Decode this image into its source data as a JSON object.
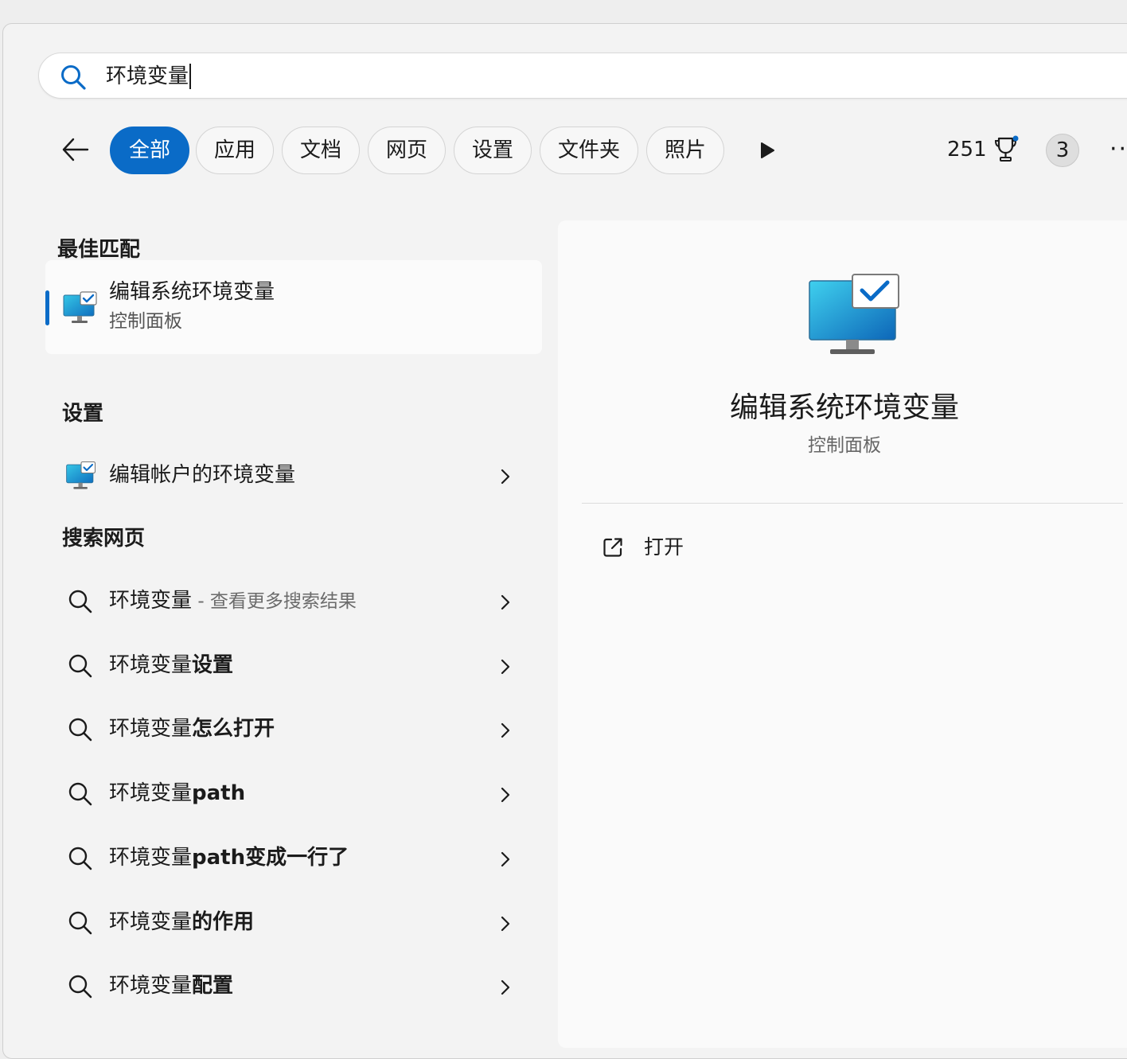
{
  "search": {
    "query": "环境变量"
  },
  "filters": [
    {
      "label": "全部",
      "active": true
    },
    {
      "label": "应用"
    },
    {
      "label": "文档"
    },
    {
      "label": "网页"
    },
    {
      "label": "设置"
    },
    {
      "label": "文件夹"
    },
    {
      "label": "照片"
    }
  ],
  "rewards": {
    "points": "251",
    "notifications": "3"
  },
  "best_match": {
    "heading": "最佳匹配",
    "title": "编辑系统环境变量",
    "subtitle": "控制面板"
  },
  "settings": {
    "heading": "设置",
    "items": [
      {
        "label": "编辑帐户的环境变量"
      }
    ]
  },
  "web": {
    "heading": "搜索网页",
    "items": [
      {
        "prefix": "环境变量",
        "bold": "",
        "hint": " - 查看更多搜索结果"
      },
      {
        "prefix": "环境变量",
        "bold": "设置",
        "hint": ""
      },
      {
        "prefix": "环境变量",
        "bold": "怎么打开",
        "hint": ""
      },
      {
        "prefix": "环境变量",
        "bold": "path",
        "hint": ""
      },
      {
        "prefix": "环境变量",
        "bold": "path变成一行了",
        "hint": ""
      },
      {
        "prefix": "环境变量",
        "bold": "的作用",
        "hint": ""
      },
      {
        "prefix": "环境变量",
        "bold": "配置",
        "hint": ""
      }
    ]
  },
  "preview": {
    "title": "编辑系统环境变量",
    "subtitle": "控制面板",
    "actions": [
      {
        "label": "打开"
      }
    ]
  },
  "colors": {
    "accent": "#0a6bc7",
    "search_icon": "#0a6bc7"
  }
}
